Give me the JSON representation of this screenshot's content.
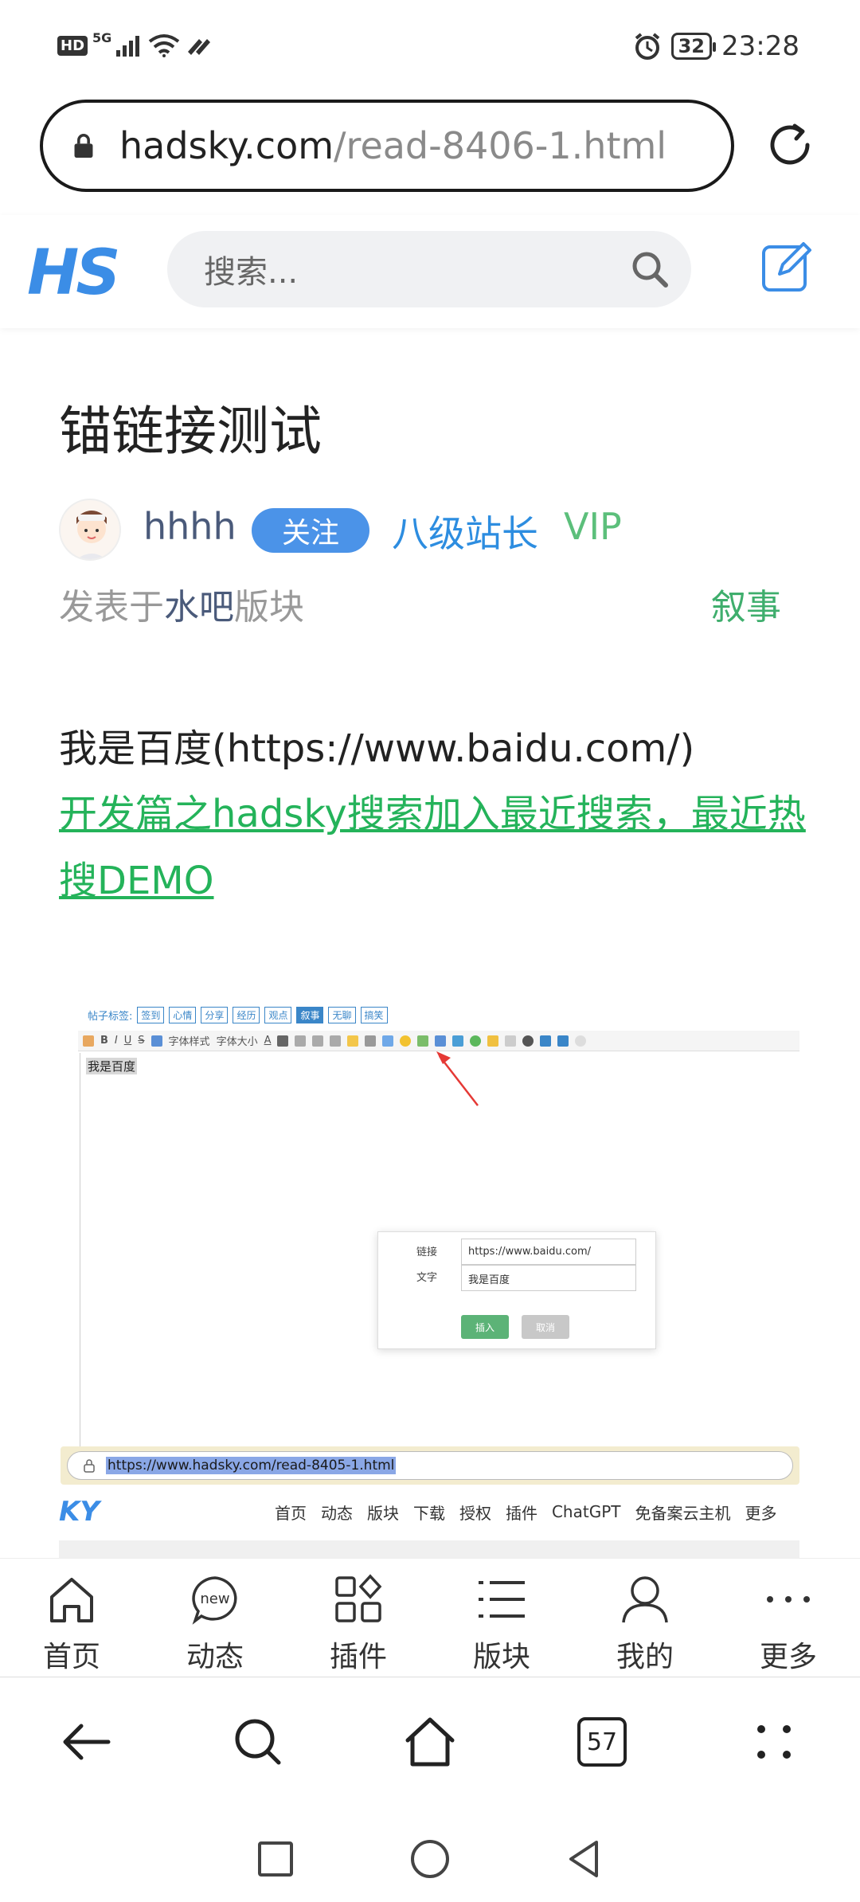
{
  "status_bar": {
    "hd": "HD",
    "network": "5G",
    "battery": "32",
    "time": "23:28"
  },
  "address_bar": {
    "domain": "hadsky.com",
    "path": "/read-8406-1.html"
  },
  "site_header": {
    "logo": "HS",
    "search_placeholder": "搜索..."
  },
  "post": {
    "title": "锚链接测试",
    "author": "hhhh",
    "follow_label": "关注",
    "rank": "八级站长",
    "vip": "VIP",
    "posted_prefix": "发表于",
    "board_name": "水吧",
    "posted_suffix": "版块",
    "tag": "叙事",
    "body_text": "我是百度(https://www.baidu.com/)",
    "link_text": "开发篇之hadsky搜索加入最近搜索，最近热搜DEMO"
  },
  "embedded_image": {
    "tag_label": "帖子标签:",
    "tags": [
      "签到",
      "心情",
      "分享",
      "经历",
      "观点",
      "叙事",
      "无聊",
      "搞笑"
    ],
    "active_tag": "叙事",
    "font_style": "字体样式",
    "font_size": "字体大小",
    "editor_text": "我是百度",
    "dialog": {
      "link_label": "链接",
      "link_value": "https://www.baidu.com/",
      "text_label": "文字",
      "text_value": "我是百度",
      "insert_label": "插入",
      "cancel_label": "取消"
    },
    "url": "https://www.hadsky.com/read-8405-1.html",
    "logo_fragment": "KY",
    "nav_items": [
      "首页",
      "动态",
      "版块",
      "下载",
      "授权",
      "插件",
      "ChatGPT",
      "免备案云主机",
      "更多"
    ]
  },
  "site_nav": [
    {
      "label": "首页",
      "icon": "home-icon"
    },
    {
      "label": "动态",
      "icon": "new-bubble-icon",
      "icon_text": "new"
    },
    {
      "label": "插件",
      "icon": "plugins-icon"
    },
    {
      "label": "版块",
      "icon": "list-icon"
    },
    {
      "label": "我的",
      "icon": "user-icon"
    },
    {
      "label": "更多",
      "icon": "more-icon"
    }
  ],
  "browser_bar": {
    "tabs_count": "57"
  },
  "colors": {
    "accent_blue": "#3b8de6",
    "link_green": "#24b35a",
    "vip_green": "#5cbf7b",
    "follow_blue": "#4b93e8"
  }
}
